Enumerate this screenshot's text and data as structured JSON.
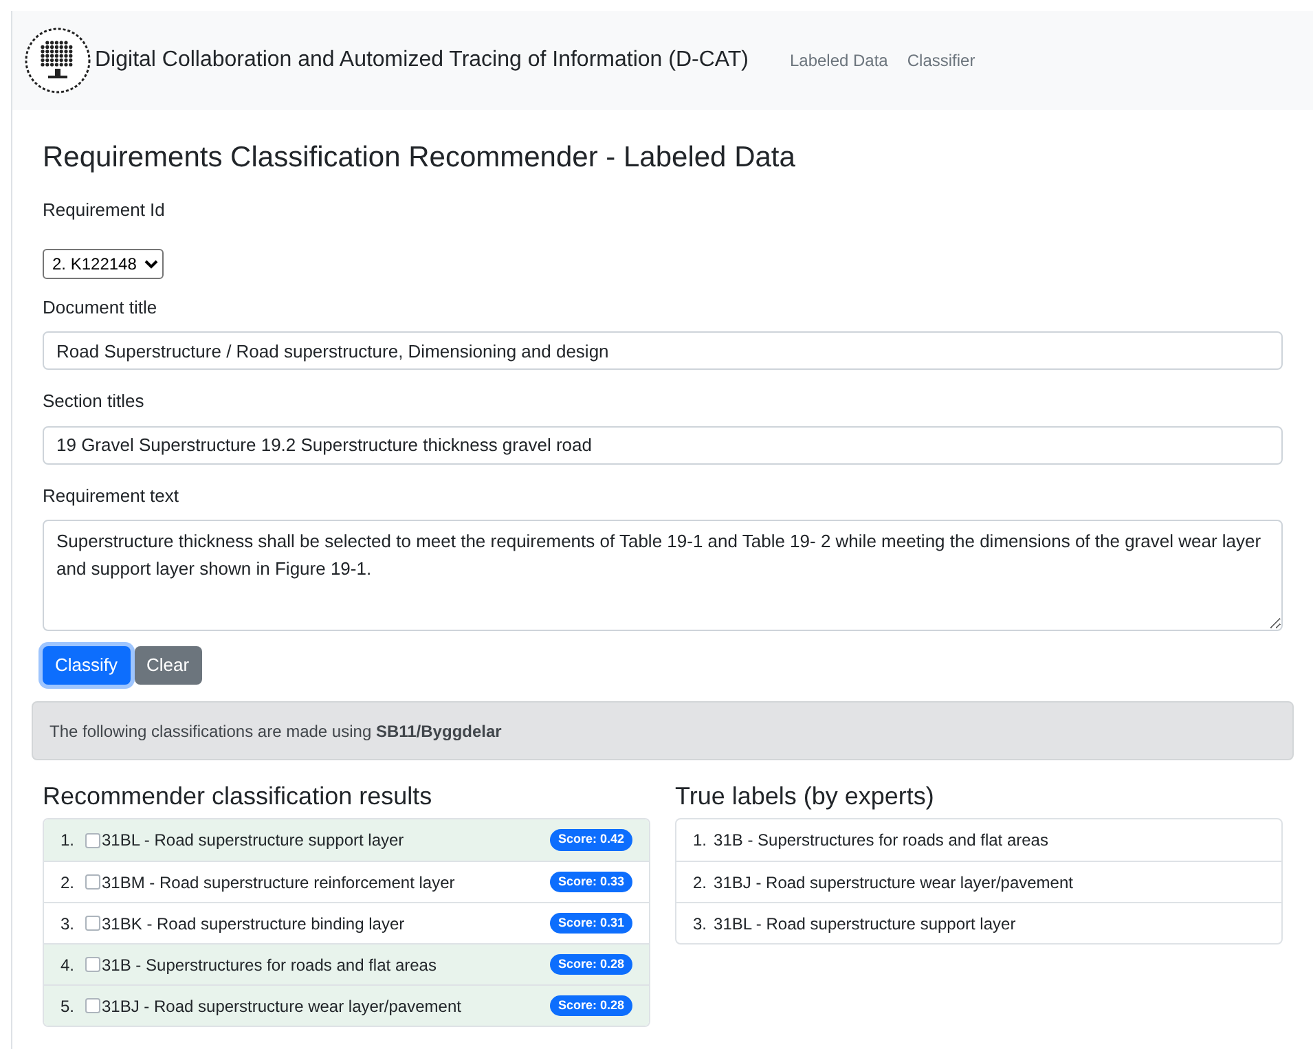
{
  "navbar": {
    "brand": "Digital Collaboration and Automized Tracing of Information (D-CAT)",
    "links": [
      {
        "label": "Labeled Data",
        "selected": false
      },
      {
        "label": "Classifier",
        "selected": false
      }
    ]
  },
  "page_title": "Requirements Classification Recommender - Labeled Data",
  "requirement_id": {
    "label": "Requirement Id",
    "value": "2. K122148"
  },
  "document_title": {
    "label": "Document title",
    "value": "Road Superstructure / Road superstructure, Dimensioning and design"
  },
  "section_titles": {
    "label": "Section titles",
    "value": "19 Gravel Superstructure 19.2 Superstructure thickness gravel road"
  },
  "requirement_text": {
    "label": "Requirement text",
    "value": "Superstructure thickness shall be selected to meet the requirements of Table 19-1 and Table 19- 2 while meeting the dimensions of the gravel wear layer and support layer shown in Figure 19-1."
  },
  "buttons": [
    {
      "label": "Classify",
      "kind": "primary"
    },
    {
      "label": "Clear",
      "kind": "secondary"
    }
  ],
  "notice": "The following classifications are made using **SB11/Byggdelar**",
  "results": {
    "title": "Recommender classification results",
    "items": [
      {
        "number": "1.",
        "label": "31BL - Road superstructure support layer",
        "score": "Score: 0.42",
        "checked": false,
        "match": true
      },
      {
        "number": "2.",
        "label": "31BM - Road superstructure reinforcement layer",
        "score": "Score: 0.33",
        "checked": false,
        "match": false
      },
      {
        "number": "3.",
        "label": "31BK - Road superstructure binding layer",
        "score": "Score: 0.31",
        "checked": false,
        "match": false
      },
      {
        "number": "4.",
        "label": "31B - Superstructures for roads and flat areas",
        "score": "Score: 0.28",
        "checked": false,
        "match": true
      },
      {
        "number": "5.",
        "label": "31BJ - Road superstructure wear layer/pavement",
        "score": "Score: 0.28",
        "checked": false,
        "match": true
      }
    ]
  },
  "true_labels": {
    "title": "True labels (by experts)",
    "items": [
      {
        "number": "1.",
        "label": "31B - Superstructures for roads and flat areas"
      },
      {
        "number": "2.",
        "label": "31BJ - Road superstructure wear layer/pavement"
      },
      {
        "number": "3.",
        "label": "31BL - Road superstructure support layer"
      }
    ]
  }
}
